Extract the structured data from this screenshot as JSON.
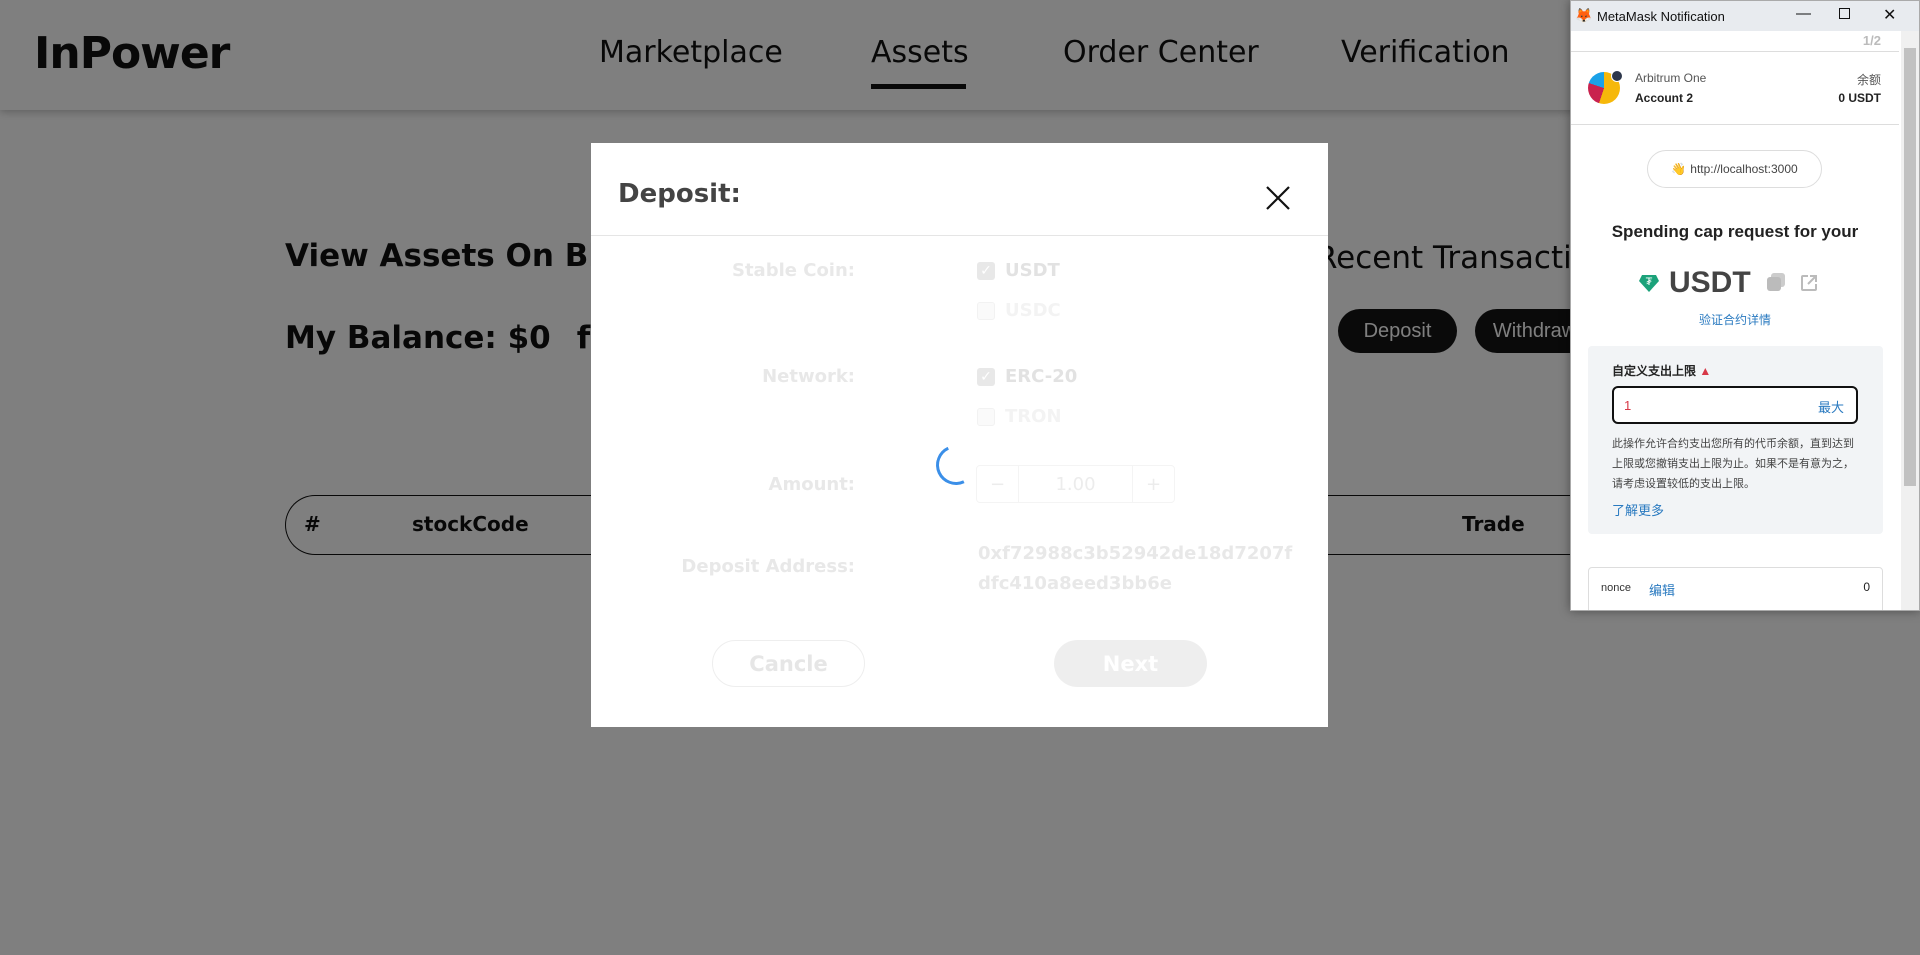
{
  "header": {
    "logo": "InPower",
    "nav": [
      {
        "label": "Marketplace"
      },
      {
        "label": "Assets",
        "active": true
      },
      {
        "label": "Order Center"
      },
      {
        "label": "Verification"
      }
    ]
  },
  "page": {
    "view_assets": "View Assets On Blo",
    "balance": "My Balance: $0",
    "balance_extra": "fre",
    "recent": "Recent Transactio",
    "deposit_button": "Deposit",
    "withdraw_button": "Withdraw",
    "table_headers": [
      "#",
      "stockCode",
      "Trade"
    ]
  },
  "modal": {
    "title": "Deposit:",
    "stable_coin_label": "Stable Coin:",
    "coins": [
      {
        "label": "USDT",
        "checked": true
      },
      {
        "label": "USDC",
        "checked": false
      }
    ],
    "network_label": "Network:",
    "networks": [
      {
        "label": "ERC-20",
        "checked": true
      },
      {
        "label": "TRON",
        "checked": false
      }
    ],
    "amount_label": "Amount:",
    "amount": "1.00",
    "minus": "−",
    "plus": "+",
    "address_label": "Deposit Address:",
    "address": "0xf72988c3b52942de18d7207fdfc410a8eed3bb6e",
    "cancel_button": "Cancle",
    "next_button": "Next",
    "loading": true
  },
  "metamask": {
    "window_title": "MetaMask Notification",
    "page_indicator": "1/2",
    "network": "Arbitrum One",
    "account": "Account 2",
    "balance_label": "余额",
    "balance": "0 USDT",
    "origin": "http://localhost:3000",
    "heading": "Spending cap request for your",
    "token": "USDT",
    "verify_link": "验证合约详情",
    "cap_label": "自定义支出上限",
    "cap_value": "1",
    "max_button": "最大",
    "warning": "此操作允许合约支出您所有的代币余额，直到达到上限或您撤销支出上限为止。如果不是有意为之，请考虑设置较低的支出上限。",
    "learn_more": "了解更多",
    "nonce_label": "nonce",
    "nonce_edit": "编辑",
    "nonce_value": "0",
    "colors": {
      "link": "#2a7ac0",
      "warning": "#d73847",
      "token_icon": "#1ba27a"
    }
  }
}
